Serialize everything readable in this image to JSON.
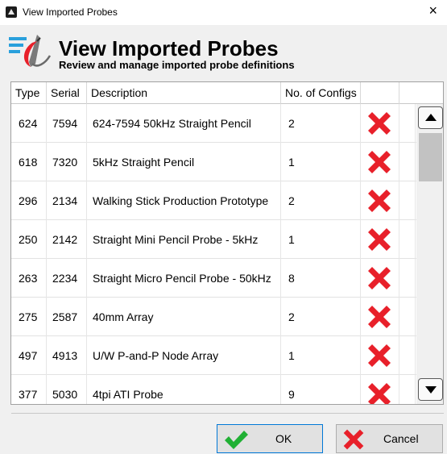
{
  "window": {
    "title": "View Imported Probes",
    "close_glyph": "×"
  },
  "header": {
    "title": "View Imported Probes",
    "subtitle": "Review and manage imported probe definitions",
    "icon": "probe-list-icon"
  },
  "table": {
    "columns": {
      "type": "Type",
      "serial": "Serial",
      "description": "Description",
      "configs": "No. of Configs"
    },
    "rows": [
      {
        "type": "624",
        "serial": "7594",
        "description": "624-7594 50kHz Straight Pencil",
        "configs": "2"
      },
      {
        "type": "618",
        "serial": "7320",
        "description": "5kHz Straight Pencil",
        "configs": "1"
      },
      {
        "type": "296",
        "serial": "2134",
        "description": "Walking Stick Production Prototype",
        "configs": "2"
      },
      {
        "type": "250",
        "serial": "2142",
        "description": "Straight Mini Pencil Probe - 5kHz",
        "configs": "1"
      },
      {
        "type": "263",
        "serial": "2234",
        "description": "Straight Micro Pencil Probe - 50kHz",
        "configs": "8"
      },
      {
        "type": "275",
        "serial": "2587",
        "description": "40mm Array",
        "configs": "2"
      },
      {
        "type": "497",
        "serial": "4913",
        "description": "U/W P-and-P Node Array",
        "configs": "1"
      },
      {
        "type": "377",
        "serial": "5030",
        "description": "4tpi ATI Probe",
        "configs": "9"
      }
    ],
    "delete_icon": "red-x-delete-icon"
  },
  "buttons": {
    "ok": "OK",
    "cancel": "Cancel"
  },
  "colors": {
    "delete_red": "#e8202a",
    "ok_green": "#20b034",
    "accent_blue": "#0078d7"
  }
}
